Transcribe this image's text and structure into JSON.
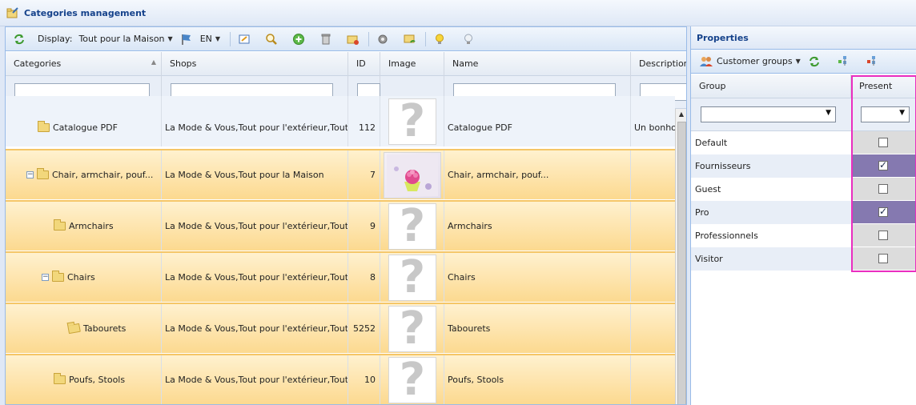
{
  "window": {
    "title": "Categories management"
  },
  "toolbar": {
    "display_label": "Display:",
    "display_value": "Tout pour la Maison",
    "language": "EN"
  },
  "columns": [
    "Categories",
    "Shops",
    "ID",
    "Image",
    "Name",
    "Description"
  ],
  "rows": [
    {
      "category": "Catalogue PDF",
      "shops": "La Mode & Vous,Tout pour l'extérieur,Tout pour",
      "id": "112",
      "image": "placeholder",
      "name": "Catalogue PDF",
      "description": "Un bonhor"
    },
    {
      "category": "Chair, armchair, pouf...",
      "shops": "La Mode & Vous,Tout pour la Maison",
      "id": "7",
      "image": "photo",
      "name": "Chair, armchair, pouf...",
      "description": ""
    },
    {
      "category": "Armchairs",
      "shops": "La Mode & Vous,Tout pour l'extérieur,Tout pour",
      "id": "9",
      "image": "placeholder",
      "name": "Armchairs",
      "description": ""
    },
    {
      "category": "Chairs",
      "shops": "La Mode & Vous,Tout pour l'extérieur,Tout pour",
      "id": "8",
      "image": "placeholder",
      "name": "Chairs",
      "description": ""
    },
    {
      "category": "Tabourets",
      "shops": "La Mode & Vous,Tout pour l'extérieur,Tout pour",
      "id": "5252",
      "image": "placeholder",
      "name": "Tabourets",
      "description": ""
    },
    {
      "category": "Poufs, Stools",
      "shops": "La Mode & Vous,Tout pour l'extérieur,Tout pour",
      "id": "10",
      "image": "placeholder",
      "name": "Poufs, Stools",
      "description": ""
    }
  ],
  "properties": {
    "title": "Properties",
    "toolbar_label": "Customer groups",
    "columns": [
      "Group",
      "Present"
    ],
    "groups": [
      {
        "name": "Default",
        "present": false
      },
      {
        "name": "Fournisseurs",
        "present": true
      },
      {
        "name": "Guest",
        "present": false
      },
      {
        "name": "Pro",
        "present": true
      },
      {
        "name": "Professionnels",
        "present": false
      },
      {
        "name": "Visitor",
        "present": false
      }
    ]
  },
  "colors": {
    "selected_row": "#fcd98f",
    "checked_cell": "#8579b0",
    "highlight_border": "#ea2ec0",
    "header_text": "#15428b"
  },
  "question_mark": "?"
}
